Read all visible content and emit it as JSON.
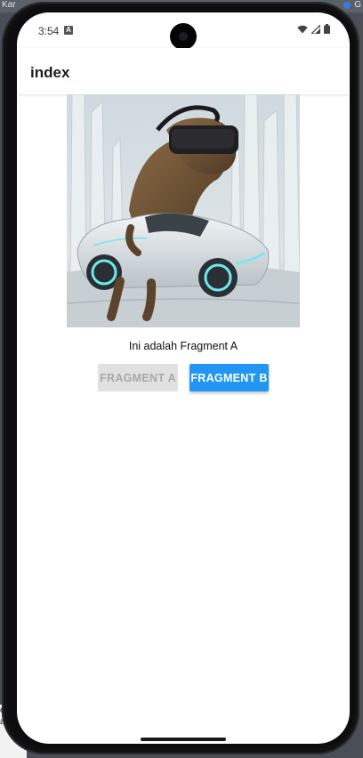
{
  "host": {
    "top_left_text": "Kar",
    "top_right_text": "G",
    "bottom_lines": [
      "er",
      "alan"
    ]
  },
  "status_bar": {
    "time": "3:54",
    "notification_icon": "A",
    "icons": [
      "wifi-icon",
      "cellular-signal-icon",
      "battery-icon"
    ]
  },
  "app_bar": {
    "title": "index"
  },
  "content": {
    "image_alt": "dinosaur wearing VR headset in futuristic car",
    "fragment_text": "Ini adalah Fragment A",
    "buttons": {
      "fragment_a": "FRAGMENT A",
      "fragment_b": "FRAGMENT B"
    }
  },
  "colors": {
    "accent": "#2196f3",
    "disabled_bg": "#e1e1e1",
    "disabled_text": "#a8a8a8"
  }
}
